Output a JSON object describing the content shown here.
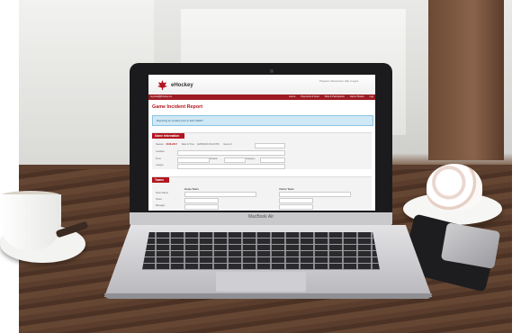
{
  "screen": {
    "top_links": "Programs | Resources | Help | Logout",
    "logo": "eHockey",
    "user_email": "myemail@hockey.ca",
    "nav_items": [
      "Home",
      "Payments & Fees",
      "Role & Participants",
      "Game Sheets",
      "Log"
    ],
    "page_title": "Game Incident Report",
    "info_message": "Reporting an incident prior to 2017-2018?",
    "game_info": {
      "heading": "Game Information",
      "season_label": "Season",
      "season_value": "2016-2017",
      "date_label": "Date & Time",
      "date_value": "14/08/2016 06:24 PM",
      "game_no_label": "Game #",
      "location_label": "Location",
      "zone_label": "Zone",
      "division_label": "Division",
      "category_label": "Category",
      "league_label": "League"
    },
    "teams": {
      "heading": "Teams",
      "home_label": "Home Team",
      "visitor_label": "Visitor Team",
      "team_name_label": "Team Name",
      "score_label": "Score",
      "manager_label": "Manager"
    }
  },
  "laptop_brand": "MacBook Air"
}
